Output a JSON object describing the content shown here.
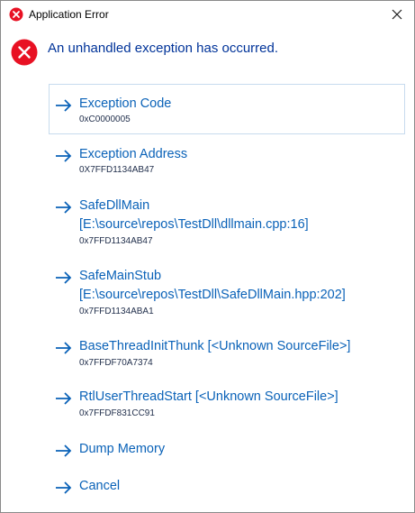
{
  "window": {
    "title": "Application Error"
  },
  "header": {
    "message": "An unhandled exception has occurred."
  },
  "commands": [
    {
      "label": "Exception Code",
      "note": "0xC0000005"
    },
    {
      "label": "Exception Address",
      "note": "0X7FFD1134AB47"
    },
    {
      "label": "SafeDllMain",
      "label2": "[E:\\source\\repos\\TestDll\\dllmain.cpp:16]",
      "note": "0x7FFD1134AB47"
    },
    {
      "label": "SafeMainStub",
      "label2": "[E:\\source\\repos\\TestDll\\SafeDllMain.hpp:202]",
      "note": "0x7FFD1134ABA1"
    },
    {
      "label": "BaseThreadInitThunk [<Unknown SourceFile>]",
      "note": "0x7FFDF70A7374"
    },
    {
      "label": "RtlUserThreadStart [<Unknown SourceFile>]",
      "note": "0x7FFDF831CC91"
    },
    {
      "label": "Dump Memory"
    },
    {
      "label": "Cancel"
    }
  ],
  "colors": {
    "accent": "#0a62b8",
    "error": "#e81123",
    "focus_border": "#c7dbee"
  },
  "icons": {
    "title": "error-icon",
    "header": "error-icon",
    "command": "arrow-right-icon",
    "close": "close-icon"
  }
}
